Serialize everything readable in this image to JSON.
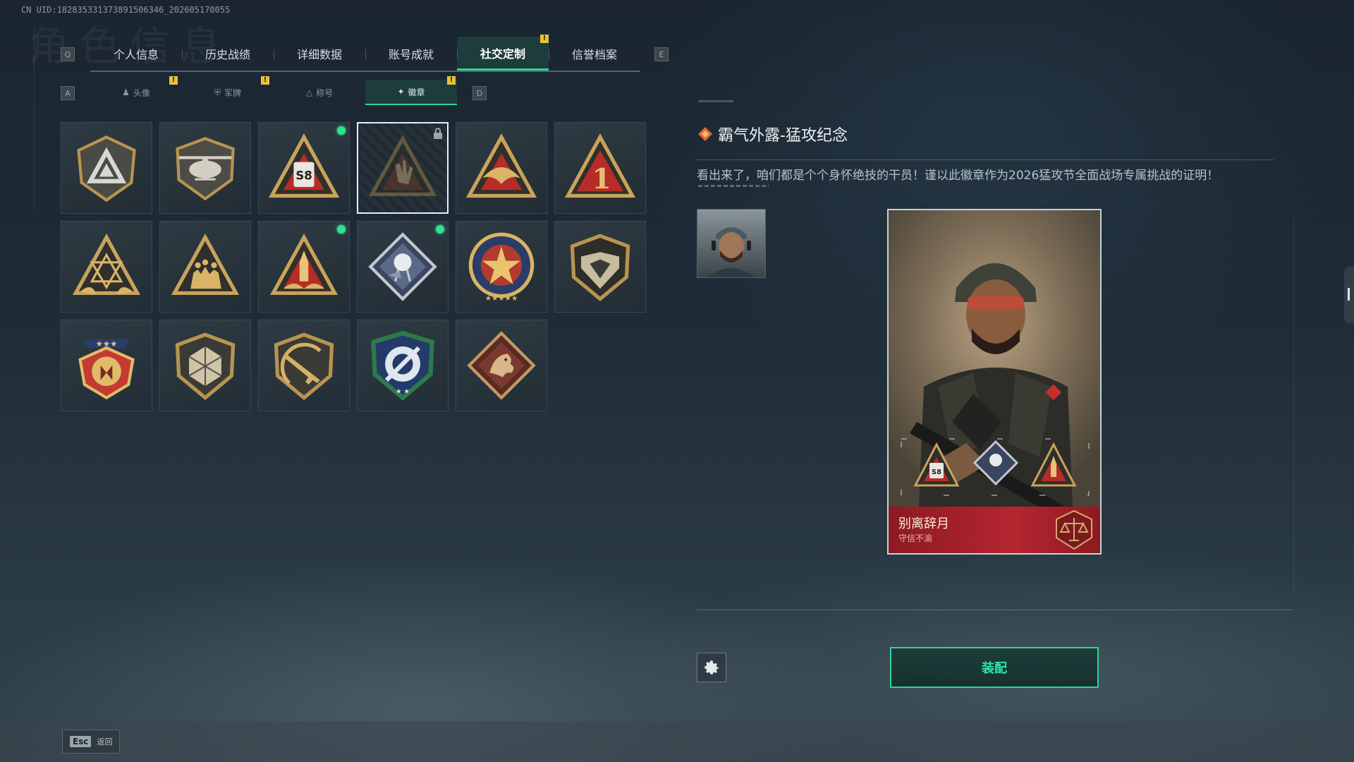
{
  "uid_text": "CN UID:182835331373891506346_202605170055",
  "watermark": "角色信息",
  "main_tabs": {
    "left_key": "Q",
    "right_key": "E",
    "items": [
      {
        "label": "个人信息"
      },
      {
        "label": "历史战绩"
      },
      {
        "label": "详细数据"
      },
      {
        "label": "账号成就"
      },
      {
        "label": "社交定制",
        "active": true,
        "alert": "!"
      },
      {
        "label": "信誉档案"
      }
    ]
  },
  "sub_tabs": {
    "left_key": "A",
    "right_key": "D",
    "items": [
      {
        "label": "头像",
        "icon": "person-icon",
        "alert": "!"
      },
      {
        "label": "军牌",
        "icon": "shield-icon",
        "alert": "!"
      },
      {
        "label": "称号",
        "icon": "triangle-icon"
      },
      {
        "label": "徽章",
        "icon": "wings-icon",
        "active": true,
        "alert": "!"
      }
    ]
  },
  "badges": [
    {
      "name": "shield-triangle-badge",
      "new": false
    },
    {
      "name": "helicopter-badge",
      "new": false
    },
    {
      "name": "s8-triangle-badge",
      "new": true
    },
    {
      "name": "hand-sign-badge",
      "selected": true,
      "locked": true
    },
    {
      "name": "eagle-triangle-badge",
      "new": false
    },
    {
      "name": "number-one-badge",
      "new": false
    },
    {
      "name": "hexagram-triangle-badge",
      "new": false
    },
    {
      "name": "soldiers-triangle-badge",
      "new": false
    },
    {
      "name": "rocket-triangle-badge",
      "new": true
    },
    {
      "name": "rose-diamond-badge",
      "new": true
    },
    {
      "name": "star-medal-badge",
      "new": false
    },
    {
      "name": "wing-shield-badge",
      "new": false
    },
    {
      "name": "three-star-medal-badge",
      "new": false
    },
    {
      "name": "d20-shield-badge",
      "new": false
    },
    {
      "name": "rifle-shield-badge",
      "new": false
    },
    {
      "name": "satellite-shield-badge",
      "new": false
    },
    {
      "name": "dragon-diamond-badge",
      "new": false
    }
  ],
  "detail": {
    "title": "霸气外露-猛攻纪念",
    "description": "看出来了，咱们都是个个身怀绝技的干员！谨以此徽章作为2026猛攻节全面战场专属挑战的证明！"
  },
  "card": {
    "name": "别离辞月",
    "subtitle": "守信不渝"
  },
  "actions": {
    "equip_label": "装配"
  },
  "bottom": {
    "esc_key": "Esc",
    "esc_label": "返回"
  },
  "colors": {
    "accent": "#2fd49a",
    "alert": "#e8c23a",
    "card_red": "#b52630",
    "badge_gold": "#c9a35b"
  }
}
